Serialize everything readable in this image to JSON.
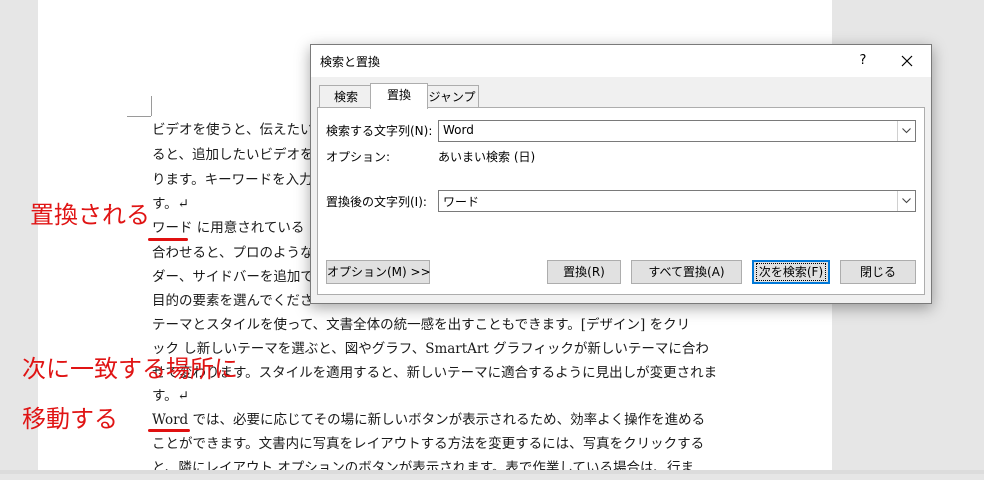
{
  "document": {
    "lines": [
      "ビデオを使うと、伝えたい",
      "ると、追加したいビデオを",
      "ります。キーワードを入力",
      "す。↵",
      "ワード に用意されている",
      "合わせると、プロのような",
      "ダー、サイドバーを追加で",
      "目的の要素を選んでくださ",
      "テーマとスタイルを使って、文書全体の統一感を出すこともできます。[デザイン] をクリ",
      "ック し新しいテーマを選ぶと、図やグラフ、SmartArt グラフィックが新しいテーマに合わ",
      "せて変わります。スタイルを適用すると、新しいテーマに適合するように見出しが変更されま",
      "す。↵",
      "Word では、必要に応じてその場に新しいボタンが表示されるため、効率よく操作を進める",
      "ことができます。文書内に写真をレイアウトする方法を変更するには、写真をクリックする",
      "と、隣にレイアウト オプションのボタンが表示されます。表で作業している場合は、行ま"
    ]
  },
  "annotations": {
    "replaced": "置換される",
    "next_match_line1": "次に一致する場所に",
    "next_match_line2": "移動する",
    "color": "#e01414"
  },
  "dialog": {
    "title": "検索と置換",
    "help": "?",
    "tabs": [
      "検索",
      "置換",
      "ジャンプ"
    ],
    "active_tab": "置換",
    "find_label": "検索する文字列(N):",
    "find_value": "Word",
    "options_label": "オプション:",
    "options_value": "あいまい検索 (日)",
    "replace_label": "置換後の文字列(I):",
    "replace_value": "ワード",
    "buttons": {
      "more": "オプション(M) >>",
      "replace": "置換(R)",
      "replace_all": "すべて置換(A)",
      "find_next": "次を検索(F)",
      "close": "閉じる"
    }
  }
}
